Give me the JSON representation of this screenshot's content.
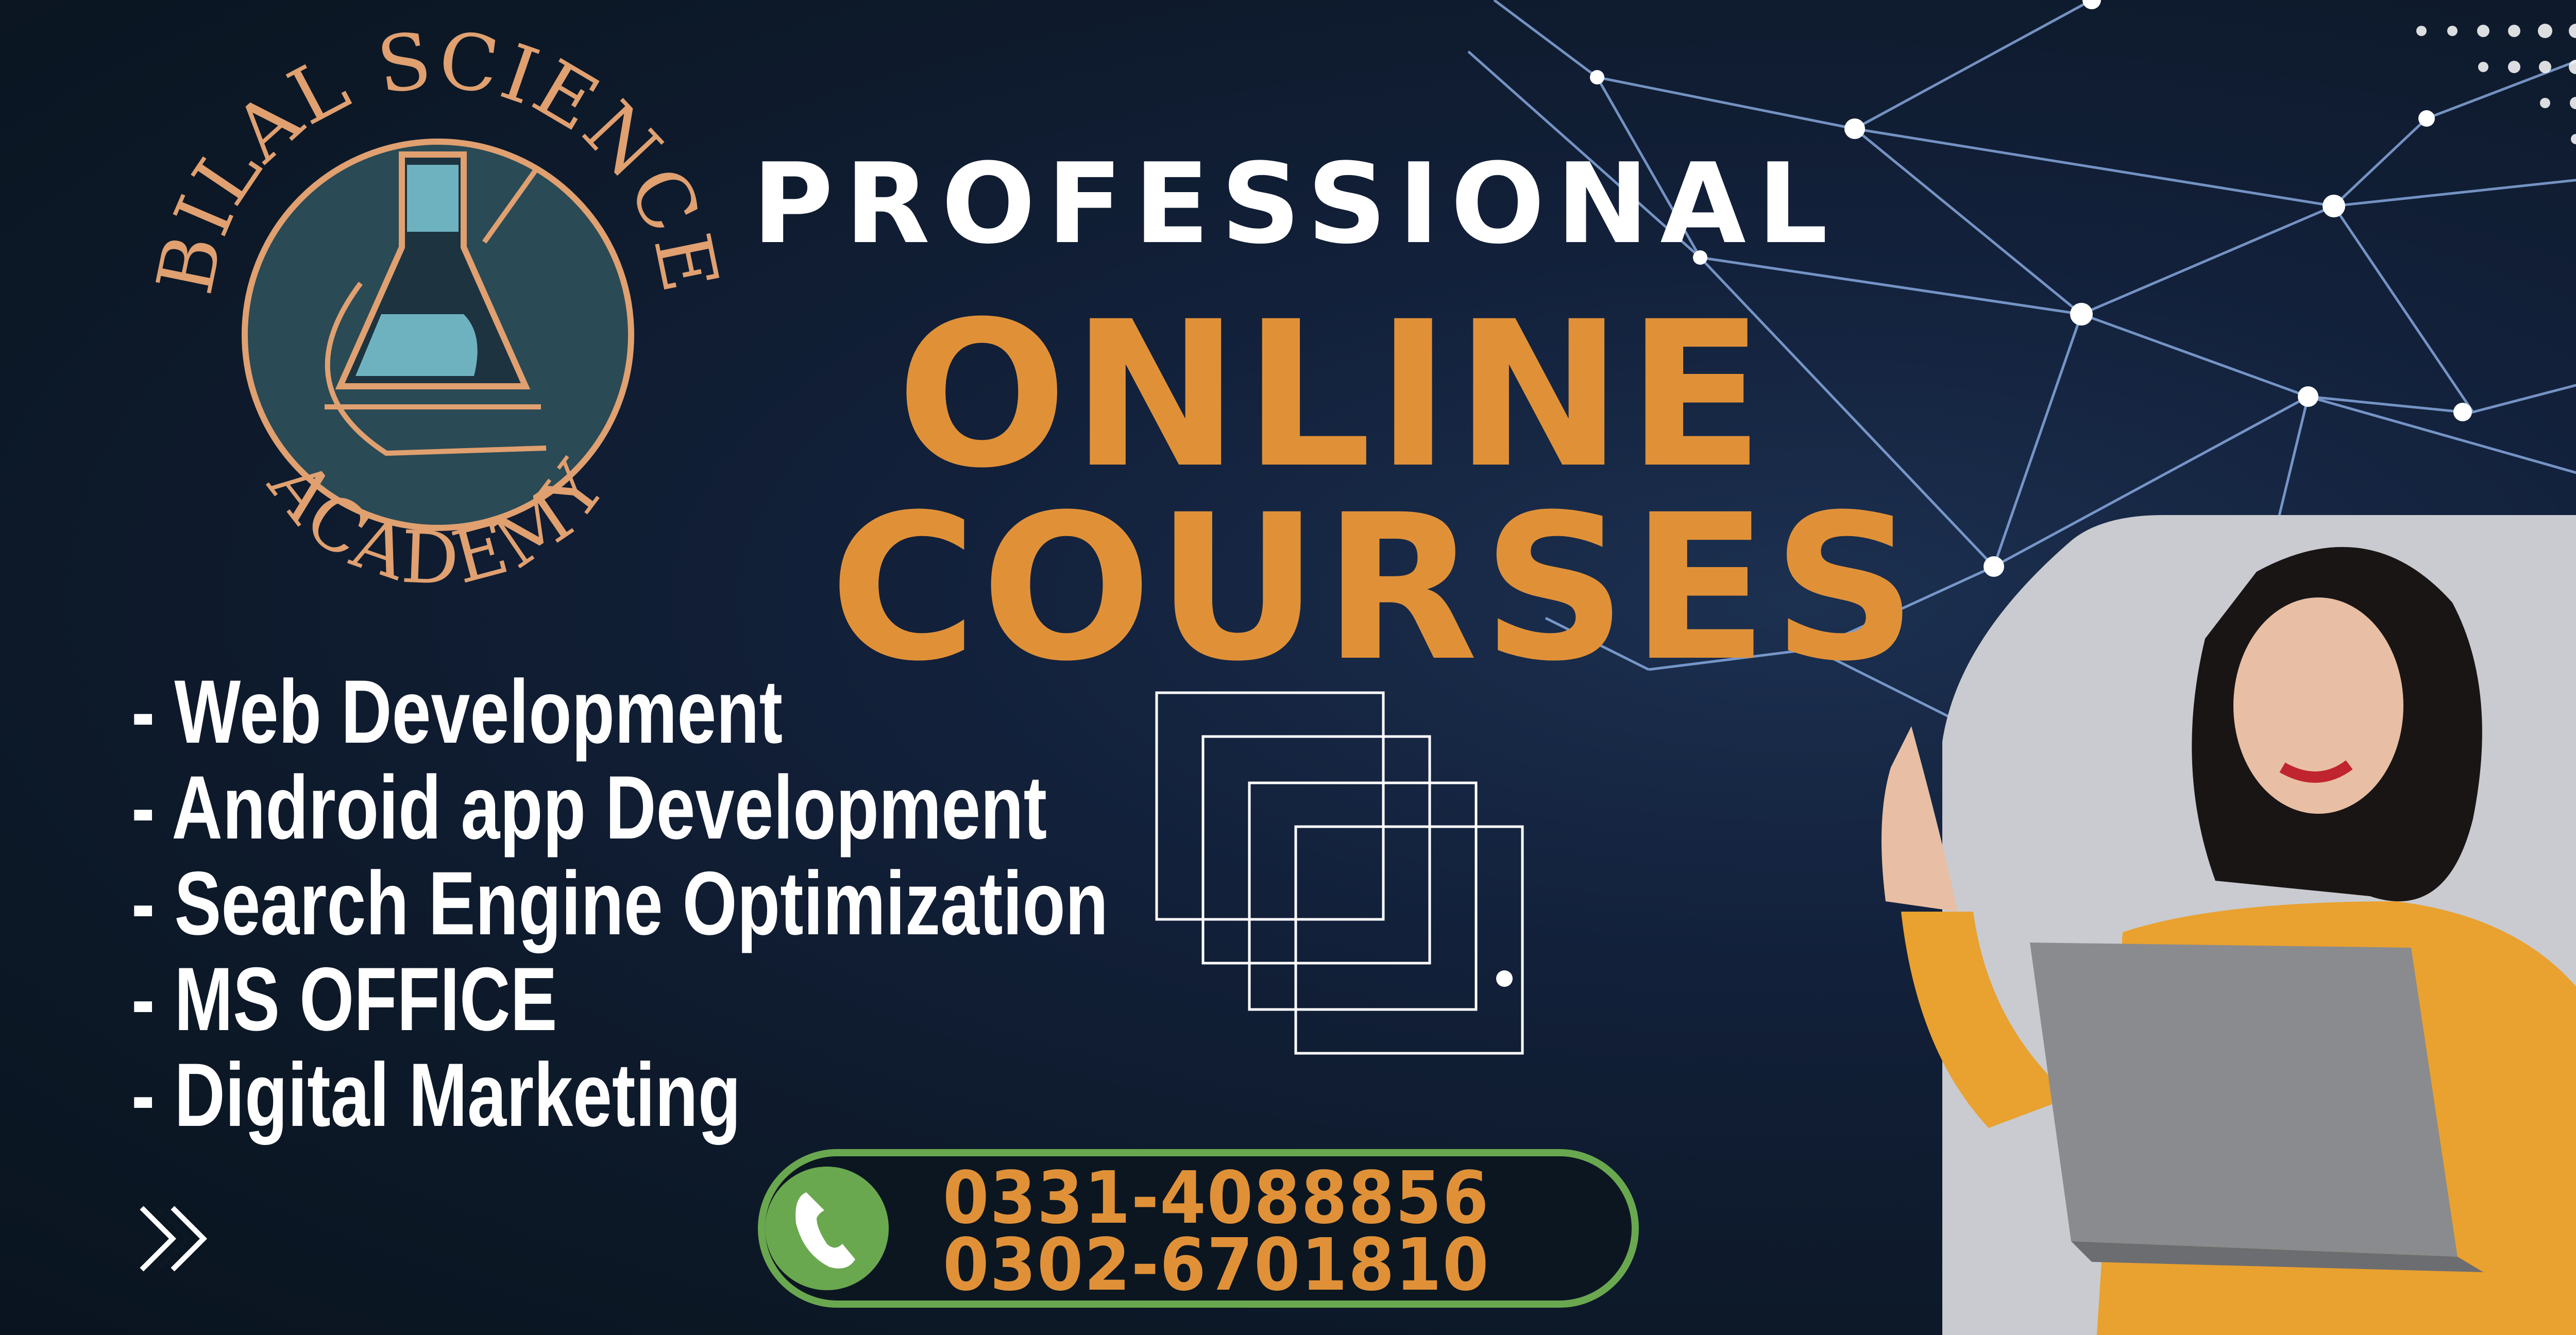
{
  "logo": {
    "top_text": "BILAL SCIENCE",
    "bottom_text": "ACADEMY",
    "colors": {
      "gold": "#e0a070",
      "teal": "#4f8f98",
      "navy": "#15263a"
    }
  },
  "headline": {
    "line1": "PROFESSIONAL",
    "line2": "ONLINE",
    "line3": "COURSES"
  },
  "courses": [
    "- Web Development",
    "- Android app Development",
    "- Search Engine Optimization",
    "- MS OFFICE",
    "- Digital Marketing"
  ],
  "contact": {
    "icon": "phone-icon",
    "phones": [
      "0331-4088856",
      "0302-6701810"
    ]
  },
  "decor": {
    "chevrons_icon": "double-chevron-right-icon"
  },
  "colors": {
    "background": "#0f1b2a",
    "accent_orange": "#e09138",
    "accent_green": "#6aa84f",
    "white": "#ffffff"
  }
}
